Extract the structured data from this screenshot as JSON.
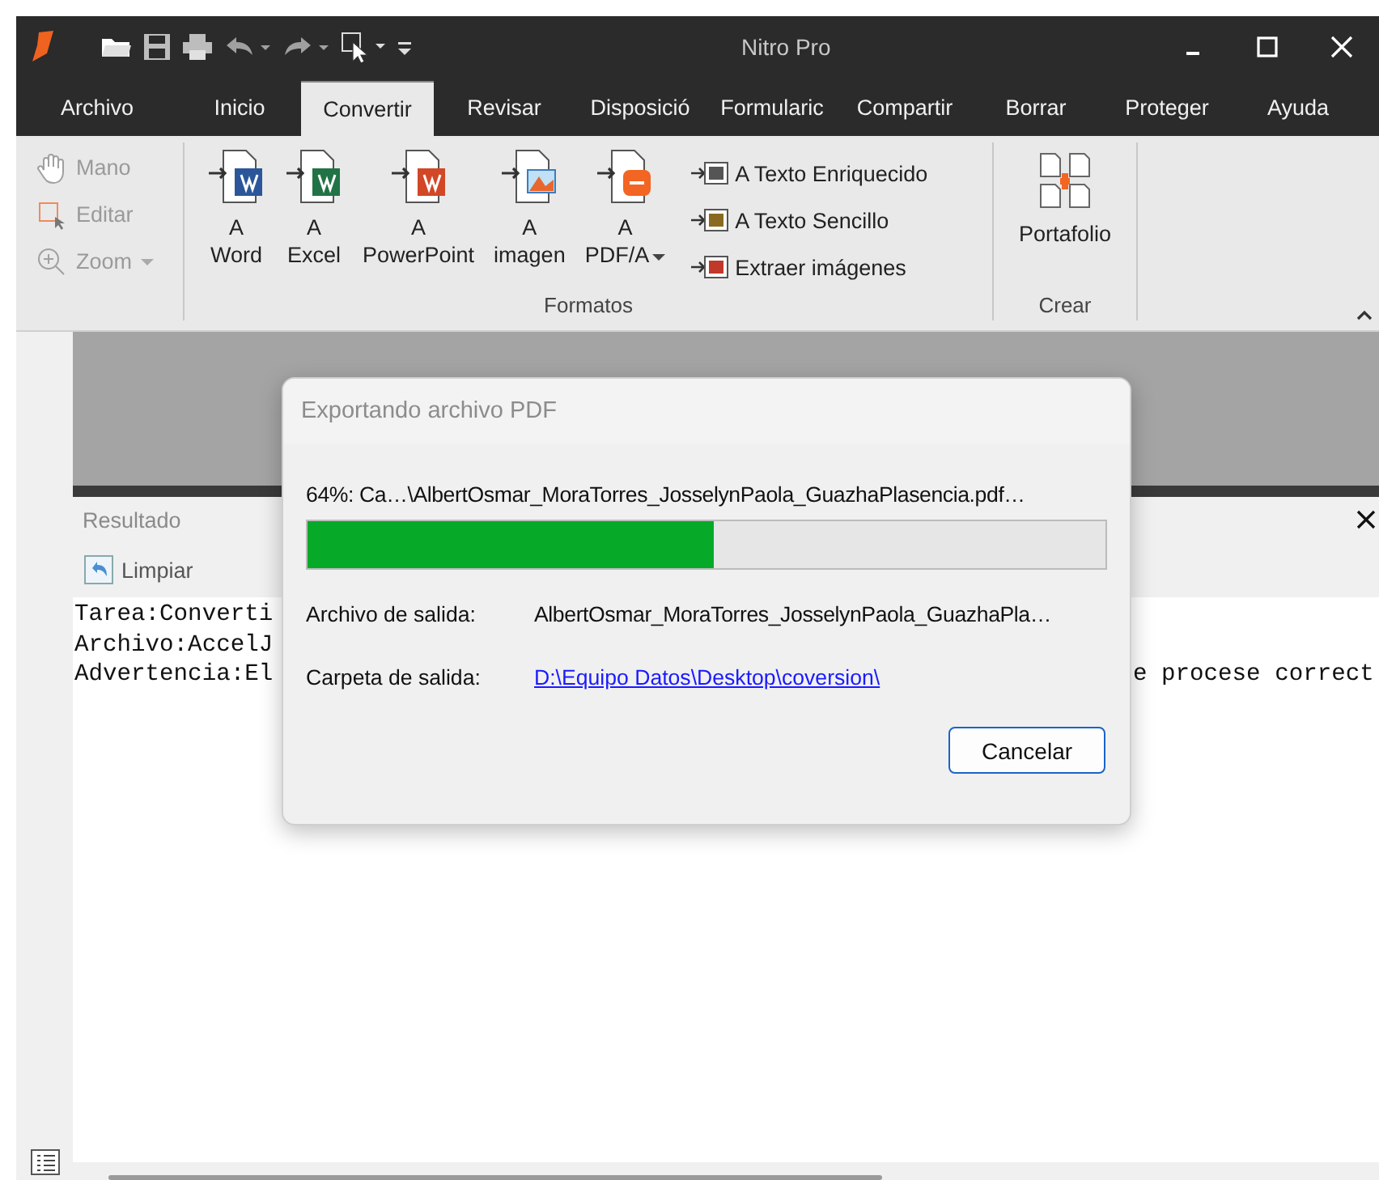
{
  "window": {
    "title": "Nitro Pro"
  },
  "tabs": [
    {
      "label": "Archivo",
      "selected": false
    },
    {
      "label": "Inicio",
      "selected": false
    },
    {
      "label": "Convertir",
      "selected": true
    },
    {
      "label": "Revisar",
      "selected": false
    },
    {
      "label": "Disposició",
      "selected": false
    },
    {
      "label": "Formularic",
      "selected": false
    },
    {
      "label": "Compartir",
      "selected": false
    },
    {
      "label": "Borrar",
      "selected": false
    },
    {
      "label": "Proteger",
      "selected": false
    },
    {
      "label": "Ayuda",
      "selected": false
    }
  ],
  "ribbon": {
    "tools": [
      {
        "kind": "hand",
        "label": "Mano",
        "disabled": true
      },
      {
        "kind": "edit",
        "label": "Editar",
        "disabled": true
      },
      {
        "kind": "zoom",
        "label": "Zoom",
        "disabled": true
      }
    ],
    "formatos": {
      "label": "Formatos",
      "buttons": [
        {
          "kind": "word",
          "lines": [
            "A",
            "Word"
          ],
          "dropdown": false
        },
        {
          "kind": "excel",
          "lines": [
            "A",
            "Excel"
          ],
          "dropdown": false
        },
        {
          "kind": "powerpoint",
          "lines": [
            "A",
            "PowerPoint"
          ],
          "dropdown": false
        },
        {
          "kind": "image",
          "lines": [
            "A",
            "imagen"
          ],
          "dropdown": false
        },
        {
          "kind": "pdfa",
          "lines": [
            "A",
            "PDF/A"
          ],
          "dropdown": true
        }
      ],
      "small_buttons": [
        {
          "kind": "rtf",
          "label": "A Texto Enriquecido"
        },
        {
          "kind": "txt",
          "label": "A Texto Sencillo"
        },
        {
          "kind": "extract",
          "label": "Extraer imágenes"
        }
      ]
    },
    "crear": {
      "label": "Crear",
      "button": "Portafolio"
    }
  },
  "results": {
    "title": "Resultado",
    "clear_button": "Limpiar",
    "log": [
      {
        "left": "Tarea:Converti"
      },
      {
        "left": "Archivo:AccelJ"
      },
      {
        "left": "Advertencia:El",
        "right": "e procese correct"
      }
    ]
  },
  "dialog": {
    "title": "Exportando archivo PDF",
    "progress_text": "64%: Ca…\\AlbertOsmar_MoraTorres_JosselynPaola_GuazhaPlasencia.pdf…",
    "progress": {
      "level": 0.51
    },
    "fields": [
      {
        "kind": "text",
        "label": "Archivo de salida:",
        "value": "AlbertOsmar_MoraTorres_JosselynPaola_GuazhaPla…"
      },
      {
        "kind": "link",
        "label": "Carpeta de salida:",
        "value": "D:\\Equipo Datos\\Desktop\\coversion\\"
      }
    ],
    "cancel_button": "Cancelar"
  }
}
